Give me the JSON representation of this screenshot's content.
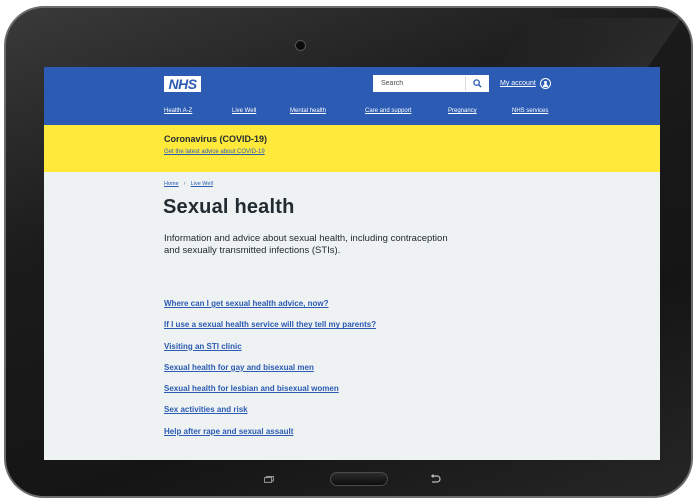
{
  "header": {
    "logo": "NHS",
    "search": {
      "placeholder": "Search"
    },
    "account_label": "My account"
  },
  "nav": {
    "items": [
      {
        "label": "Health A-Z"
      },
      {
        "label": "Live Well"
      },
      {
        "label": "Mental health"
      },
      {
        "label": "Care and support"
      },
      {
        "label": "Pregnancy"
      },
      {
        "label": "NHS services"
      }
    ]
  },
  "banner": {
    "title": "Coronavirus (COVID-19)",
    "link": "Get the latest advice about COVID-19"
  },
  "breadcrumb": [
    {
      "label": "Home"
    },
    {
      "label": "Live Well"
    }
  ],
  "page": {
    "title": "Sexual health",
    "lead": "Information and advice about sexual health, including contraception and sexually transmitted infections (STIs).",
    "links": [
      {
        "label": "Where can I get sexual health advice, now?"
      },
      {
        "label": "If I use a sexual health service will they tell my parents?"
      },
      {
        "label": "Visiting an STI clinic"
      },
      {
        "label": "Sexual health for gay and bisexual men"
      },
      {
        "label": "Sexual health for lesbian and bisexual women"
      },
      {
        "label": "Sex activities and risk"
      },
      {
        "label": "Help after rape and sexual assault"
      }
    ]
  },
  "icons": {
    "search": "search-icon",
    "account": "user-icon",
    "recent": "recent-apps-icon",
    "back": "back-icon"
  },
  "colors": {
    "nhs_blue": "#2b5bb3",
    "banner_yellow": "#ffe93b",
    "page_bg": "#eef2f2",
    "text": "#212b32"
  }
}
